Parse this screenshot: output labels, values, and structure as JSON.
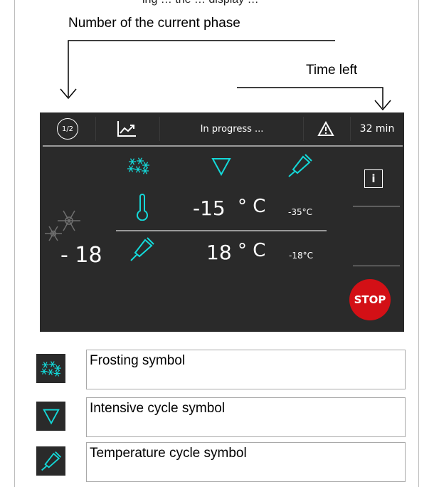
{
  "annotations": {
    "cutoff_top": "ing … the … display …",
    "phase_number": "Number of the current phase",
    "time_left": "Time left"
  },
  "screen": {
    "phase_badge": "1/2",
    "status": "In progress ...",
    "time": "32 min",
    "set_temp": "-15",
    "set_temp_unit": "° C",
    "set_temp_small": "-35°C",
    "probe_temp": "18",
    "probe_temp_unit": "° C",
    "probe_temp_small": "-18°C",
    "side_temp": "- 18",
    "info_label": "i",
    "stop_label": "STOP"
  },
  "legend": [
    {
      "icon": "frost-icon",
      "label": "Frosting symbol"
    },
    {
      "icon": "intensive-cycle-icon",
      "label": "Intensive cycle symbol"
    },
    {
      "icon": "core-probe-icon",
      "label": "Temperature cycle symbol"
    }
  ],
  "colors": {
    "screen_bg": "#2a2a2a",
    "accent_cyan": "#14d8d8",
    "stop_red": "#d31016",
    "divider": "#9a9a9a"
  }
}
